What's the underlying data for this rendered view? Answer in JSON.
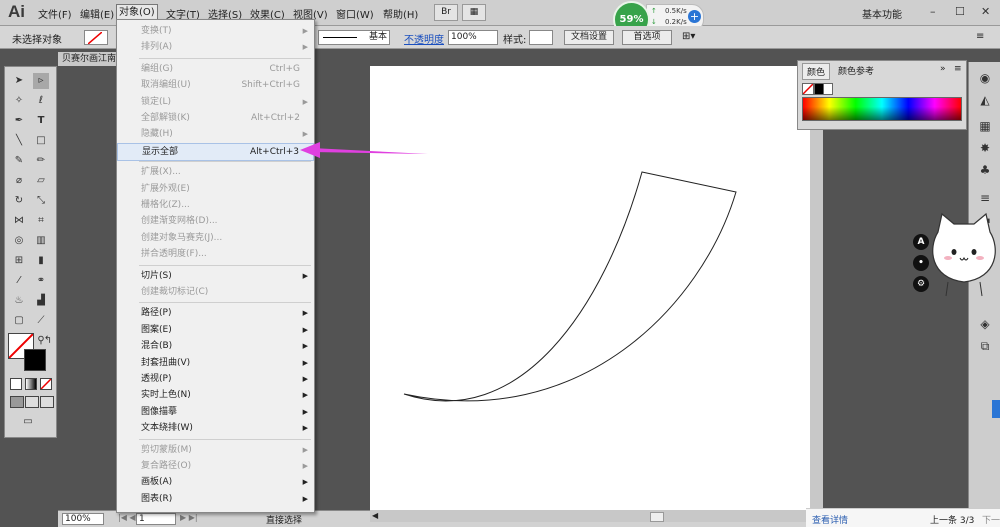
{
  "app": {
    "logo": "Ai",
    "workspace": "基本功能",
    "window_min": "–",
    "window_max": "☐",
    "window_close": "✕"
  },
  "menubar": {
    "items": [
      "文件(F)",
      "编辑(E)",
      "对象(O)",
      "文字(T)",
      "选择(S)",
      "效果(C)",
      "视图(V)",
      "窗口(W)",
      "帮助(H)"
    ],
    "active_index": 2
  },
  "net_widget": {
    "percent": "59%",
    "up": "0.5K/s",
    "down": "0.2K/s"
  },
  "control_bar": {
    "selection_label": "未选择对象",
    "stroke_style": "基本",
    "opacity_link": "不透明度",
    "opacity_value": "100%",
    "style_label": "样式:",
    "doc_settings": "文档设置",
    "preferences": "首选项"
  },
  "document": {
    "tab_title": "贝赛尔画江南"
  },
  "object_menu": [
    {
      "label": "变换(T)",
      "shortcut": "",
      "submenu": true,
      "disabled": true
    },
    {
      "label": "排列(A)",
      "shortcut": "",
      "submenu": true,
      "disabled": true
    },
    {
      "sep": true
    },
    {
      "label": "编组(G)",
      "shortcut": "Ctrl+G",
      "submenu": false,
      "disabled": true
    },
    {
      "label": "取消编组(U)",
      "shortcut": "Shift+Ctrl+G",
      "submenu": false,
      "disabled": true
    },
    {
      "label": "锁定(L)",
      "shortcut": "",
      "submenu": true,
      "disabled": true
    },
    {
      "label": "全部解锁(K)",
      "shortcut": "Alt+Ctrl+2",
      "submenu": false,
      "disabled": true
    },
    {
      "label": "隐藏(H)",
      "shortcut": "",
      "submenu": true,
      "disabled": true
    },
    {
      "label": "显示全部",
      "shortcut": "Alt+Ctrl+3",
      "submenu": false,
      "disabled": false,
      "highlight": true
    },
    {
      "sep": true
    },
    {
      "label": "扩展(X)...",
      "shortcut": "",
      "submenu": false,
      "disabled": true
    },
    {
      "label": "扩展外观(E)",
      "shortcut": "",
      "submenu": false,
      "disabled": true
    },
    {
      "label": "栅格化(Z)...",
      "shortcut": "",
      "submenu": false,
      "disabled": true
    },
    {
      "label": "创建渐变网格(D)...",
      "shortcut": "",
      "submenu": false,
      "disabled": true
    },
    {
      "label": "创建对象马赛克(J)...",
      "shortcut": "",
      "submenu": false,
      "disabled": true
    },
    {
      "label": "拼合透明度(F)...",
      "shortcut": "",
      "submenu": false,
      "disabled": true
    },
    {
      "sep": true
    },
    {
      "label": "切片(S)",
      "shortcut": "",
      "submenu": true,
      "disabled": false
    },
    {
      "label": "创建裁切标记(C)",
      "shortcut": "",
      "submenu": false,
      "disabled": true
    },
    {
      "sep": true
    },
    {
      "label": "路径(P)",
      "shortcut": "",
      "submenu": true,
      "disabled": false
    },
    {
      "label": "图案(E)",
      "shortcut": "",
      "submenu": true,
      "disabled": false
    },
    {
      "label": "混合(B)",
      "shortcut": "",
      "submenu": true,
      "disabled": false
    },
    {
      "label": "封套扭曲(V)",
      "shortcut": "",
      "submenu": true,
      "disabled": false
    },
    {
      "label": "透视(P)",
      "shortcut": "",
      "submenu": true,
      "disabled": false
    },
    {
      "label": "实时上色(N)",
      "shortcut": "",
      "submenu": true,
      "disabled": false
    },
    {
      "label": "图像描摹",
      "shortcut": "",
      "submenu": true,
      "disabled": false
    },
    {
      "label": "文本绕排(W)",
      "shortcut": "",
      "submenu": true,
      "disabled": false
    },
    {
      "sep": true
    },
    {
      "label": "剪切蒙版(M)",
      "shortcut": "",
      "submenu": true,
      "disabled": true
    },
    {
      "label": "复合路径(O)",
      "shortcut": "",
      "submenu": true,
      "disabled": true
    },
    {
      "label": "画板(A)",
      "shortcut": "",
      "submenu": true,
      "disabled": false
    },
    {
      "label": "图表(R)",
      "shortcut": "",
      "submenu": true,
      "disabled": false
    }
  ],
  "color_panel": {
    "tab_color": "颜色",
    "tab_guide": "颜色参考"
  },
  "status_bar": {
    "zoom": "100%",
    "page": "1",
    "tool": "直接选择"
  },
  "info_bar": {
    "details": "查看详情",
    "nav": "上一条 3/3",
    "next": "下一"
  },
  "sticker": {
    "btn_a": "A",
    "btn_b": "•",
    "btn_c": "⚙"
  },
  "colors": {
    "menu_highlight": "#e2ebf7",
    "annotation_arrow": "#e040e0",
    "net_green": "#37a34a"
  }
}
